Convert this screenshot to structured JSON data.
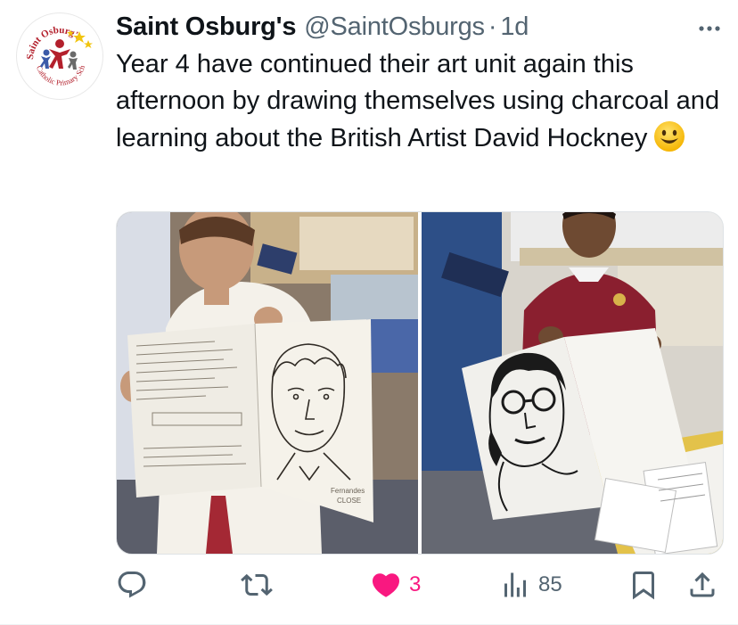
{
  "tweet": {
    "author_name": "Saint Osburg's",
    "handle": "@SaintOsburgs",
    "separator": "·",
    "timestamp": "1d",
    "text": "Year 4 have continued their art unit again this afternoon by drawing themselves using charcoal and learning about the British Artist David Hockney",
    "emoji": "smiling-face-emoji"
  },
  "avatar": {
    "logo_text_top": "Saint Osburg's",
    "logo_text_bottom": "Catholic Primary School"
  },
  "media": {
    "photos": [
      {
        "subject": "boy holding sketchbook with charcoal self-portrait",
        "sketch_labels": [
          "Pages of notes about David Hockney",
          "Fernandes",
          "CLOSE"
        ]
      },
      {
        "subject": "boy in maroon jumper holding charcoal self-portrait with glasses"
      }
    ]
  },
  "actions": {
    "reply": {
      "icon": "reply-icon",
      "count": ""
    },
    "retweet": {
      "icon": "retweet-icon",
      "count": ""
    },
    "like": {
      "icon": "heart-icon",
      "count": "3",
      "color": "#f91880"
    },
    "views": {
      "icon": "views-icon",
      "count": "85"
    },
    "bookmark": {
      "icon": "bookmark-icon"
    },
    "share": {
      "icon": "share-icon"
    }
  },
  "colors": {
    "text_primary": "#0f1419",
    "text_secondary": "#536471",
    "like_pink": "#f91880",
    "school_red": "#b3202c"
  }
}
